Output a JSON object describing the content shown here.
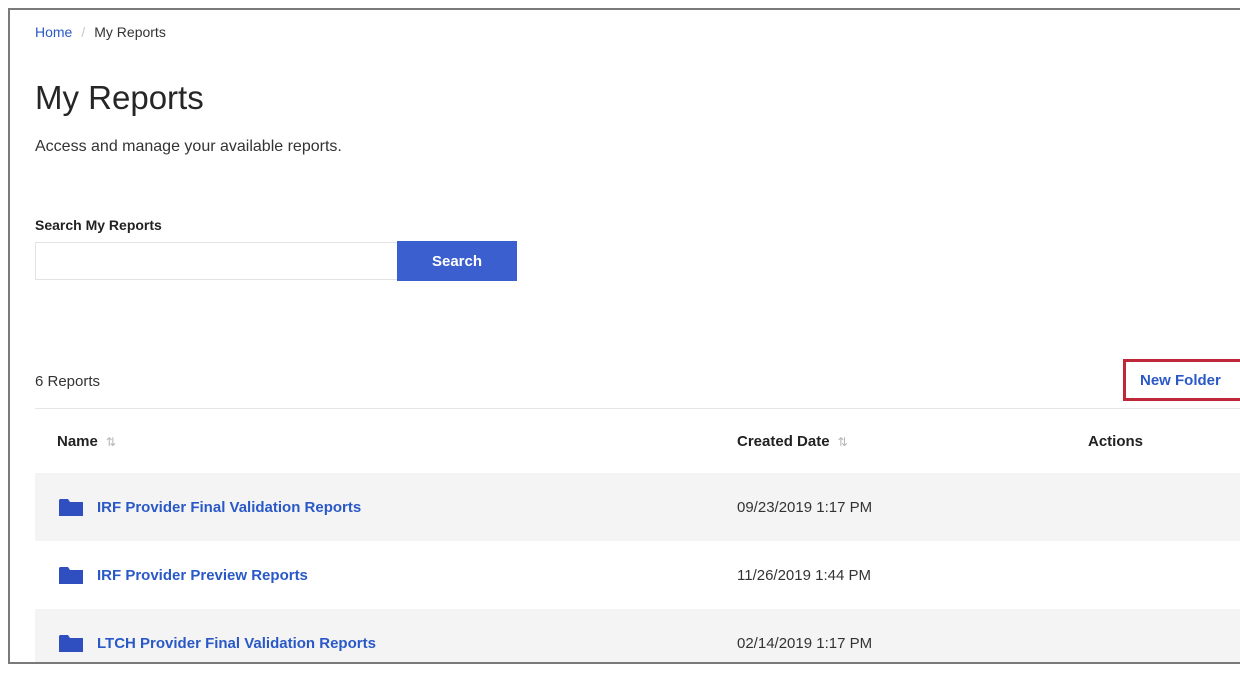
{
  "breadcrumb": {
    "home": "Home",
    "separator": "/",
    "current": "My Reports"
  },
  "page": {
    "title": "My Reports",
    "description": "Access and manage your available reports."
  },
  "search": {
    "label": "Search My Reports",
    "value": "",
    "placeholder": "",
    "button_label": "Search"
  },
  "reports": {
    "count_label": "6 Reports",
    "new_folder_label": "New Folder",
    "columns": {
      "name": "Name",
      "created_date": "Created Date",
      "actions": "Actions"
    },
    "sort_icon": "⇅",
    "rows": [
      {
        "name": "IRF Provider Final Validation Reports",
        "created_date": "09/23/2019 1:17 PM",
        "icon": "folder-icon"
      },
      {
        "name": "IRF Provider Preview Reports",
        "created_date": "11/26/2019 1:44 PM",
        "icon": "folder-icon"
      },
      {
        "name": "LTCH Provider Final Validation Reports",
        "created_date": "02/14/2019 1:17 PM",
        "icon": "folder-icon"
      }
    ]
  },
  "colors": {
    "link": "#2a59c7",
    "primary_button": "#3b5fce",
    "highlight_border": "#c0283a",
    "row_shade": "#f4f4f4",
    "folder": "#2f4fc0"
  }
}
